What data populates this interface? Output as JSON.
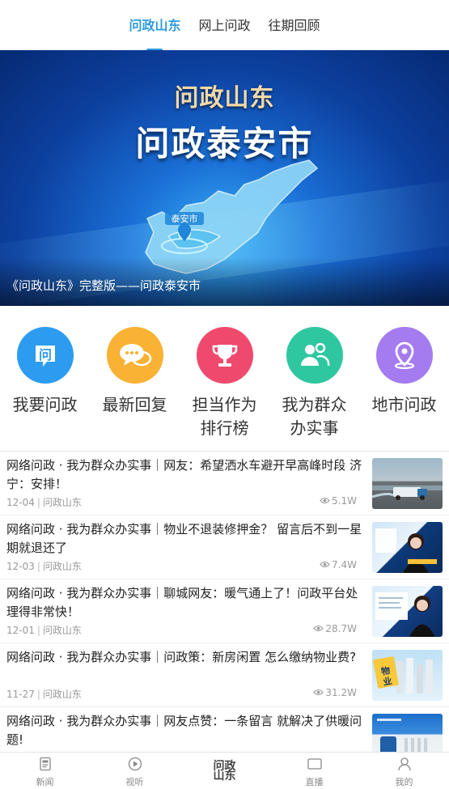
{
  "tabs": [
    {
      "label": "问政山东",
      "active": true
    },
    {
      "label": "网上问政",
      "active": false
    },
    {
      "label": "往期回顾",
      "active": false
    }
  ],
  "banner": {
    "title_small": "问政山东",
    "title_large": "问政泰安市",
    "map_label": "泰安市",
    "caption": "《问政山东》完整版——问政泰安市"
  },
  "quick_entries": [
    {
      "label": "我要问政",
      "icon": "question-chat-icon",
      "color": "#2d9cf0"
    },
    {
      "label": "最新回复",
      "icon": "message-bubbles-icon",
      "color": "#f9b233"
    },
    {
      "label": "担当作为\n排行榜",
      "icon": "trophy-icon",
      "color": "#ef4a6d"
    },
    {
      "label": "我为群众\n办实事",
      "icon": "people-icon",
      "color": "#2ec7a0"
    },
    {
      "label": "地市问政",
      "icon": "location-pin-icon",
      "color": "#a57bf0"
    }
  ],
  "news": [
    {
      "title": "网络问政 · 我为群众办实事｜网友：希望洒水车避开早高峰时段 济宁：安排！",
      "date": "12-04",
      "source": "问政山东",
      "views": "5.1W",
      "thumb": "truck"
    },
    {
      "title": "网络问政 · 我为群众办实事｜物业不退装修押金？ 留言后不到一星期就退还了",
      "date": "12-03",
      "source": "问政山东",
      "views": "7.4W",
      "thumb": "anchor"
    },
    {
      "title": "网络问政 · 我为群众办实事｜聊城网友：暖气通上了！问政平台处理得非常快！",
      "date": "12-01",
      "source": "问政山东",
      "views": "28.7W",
      "thumb": "anchor2"
    },
    {
      "title": "网络问政 · 我为群众办实事｜问政策：新房闲置 怎么缴纳物业费?",
      "date": "11-27",
      "source": "问政山东",
      "views": "31.2W",
      "thumb": "property"
    },
    {
      "title": "网络问政 · 我为群众办实事｜网友点赞：一条留言 就解决了供暖问题!",
      "date": "",
      "source": "",
      "views": "",
      "thumb": "heating"
    }
  ],
  "property_sign": "物\n业",
  "bottom_nav": [
    {
      "label": "新闻",
      "icon": "news-icon"
    },
    {
      "label": "视听",
      "icon": "play-icon"
    },
    {
      "label": "问政\n山东",
      "icon": "wenzheng-logo"
    },
    {
      "label": "直播",
      "icon": "live-icon"
    },
    {
      "label": "我的",
      "icon": "user-icon"
    }
  ]
}
